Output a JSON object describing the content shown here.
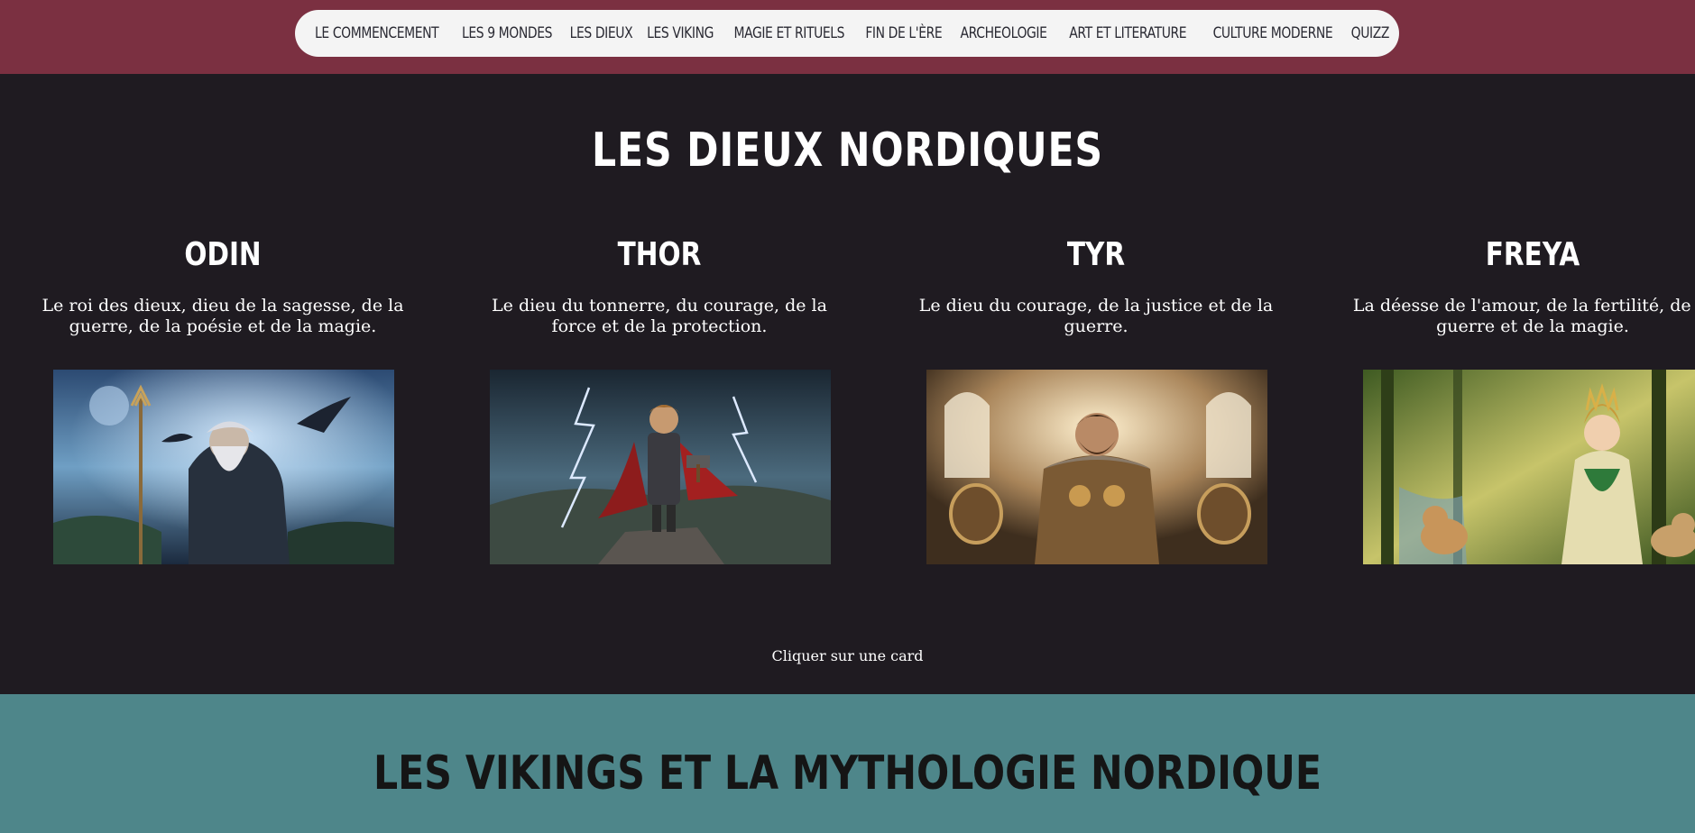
{
  "nav": {
    "items": [
      "LE COMMENCEMENT",
      "LES 9 MONDES",
      "LES DIEUX",
      "LES VIKING",
      "MAGIE ET RITUELS",
      "FIN DE L'ÈRE",
      "ARCHEOLOGIE",
      "ART ET LITERATURE",
      "CULTURE MODERNE",
      "QUIZZ"
    ]
  },
  "gods": {
    "title": "LES DIEUX NORDIQUES",
    "cards": [
      {
        "name": "ODIN",
        "description": "Le roi des dieux, dieu de la sagesse, de la guerre, de la poésie et de la magie.",
        "image_icon": "odin-illustration"
      },
      {
        "name": "THOR",
        "description": "Le dieu du tonnerre, du courage, de la force et de la protection.",
        "image_icon": "thor-illustration"
      },
      {
        "name": "TYR",
        "description": "Le dieu du courage, de la justice et de la guerre.",
        "image_icon": "tyr-illustration"
      },
      {
        "name": "FREYA",
        "description": "La déesse de l'amour, de la fertilité, de la guerre et de la magie.",
        "image_icon": "freya-illustration"
      }
    ],
    "hint": "Cliquer sur une card"
  },
  "vikings": {
    "title": "LES VIKINGS ET LA MYTHOLOGIE NORDIQUE"
  },
  "colors": {
    "header_bg": "#7b3041",
    "nav_bg": "#f4f4f4",
    "main_bg": "#1f1b21",
    "vikings_bg": "#4e868a"
  }
}
